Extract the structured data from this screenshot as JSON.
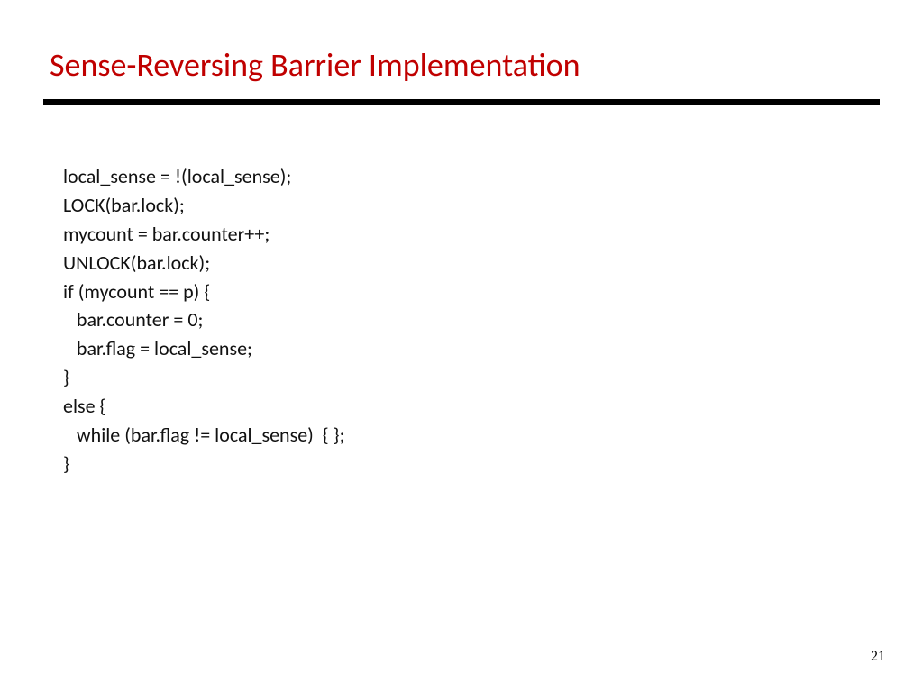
{
  "title": "Sense-Reversing Barrier Implementation",
  "code": {
    "l1": "local_sense = !(local_sense);",
    "l2": "LOCK(bar.lock);",
    "l3": "mycount = bar.counter++;",
    "l4": "UNLOCK(bar.lock);",
    "l5": "if (mycount == p) {",
    "l6": "   bar.counter = 0;",
    "l7": "   bar.flag = local_sense;",
    "l8": "}",
    "l9": "else {",
    "l10": "   while (bar.flag != local_sense)  { };",
    "l11": "}"
  },
  "page_number": "21"
}
